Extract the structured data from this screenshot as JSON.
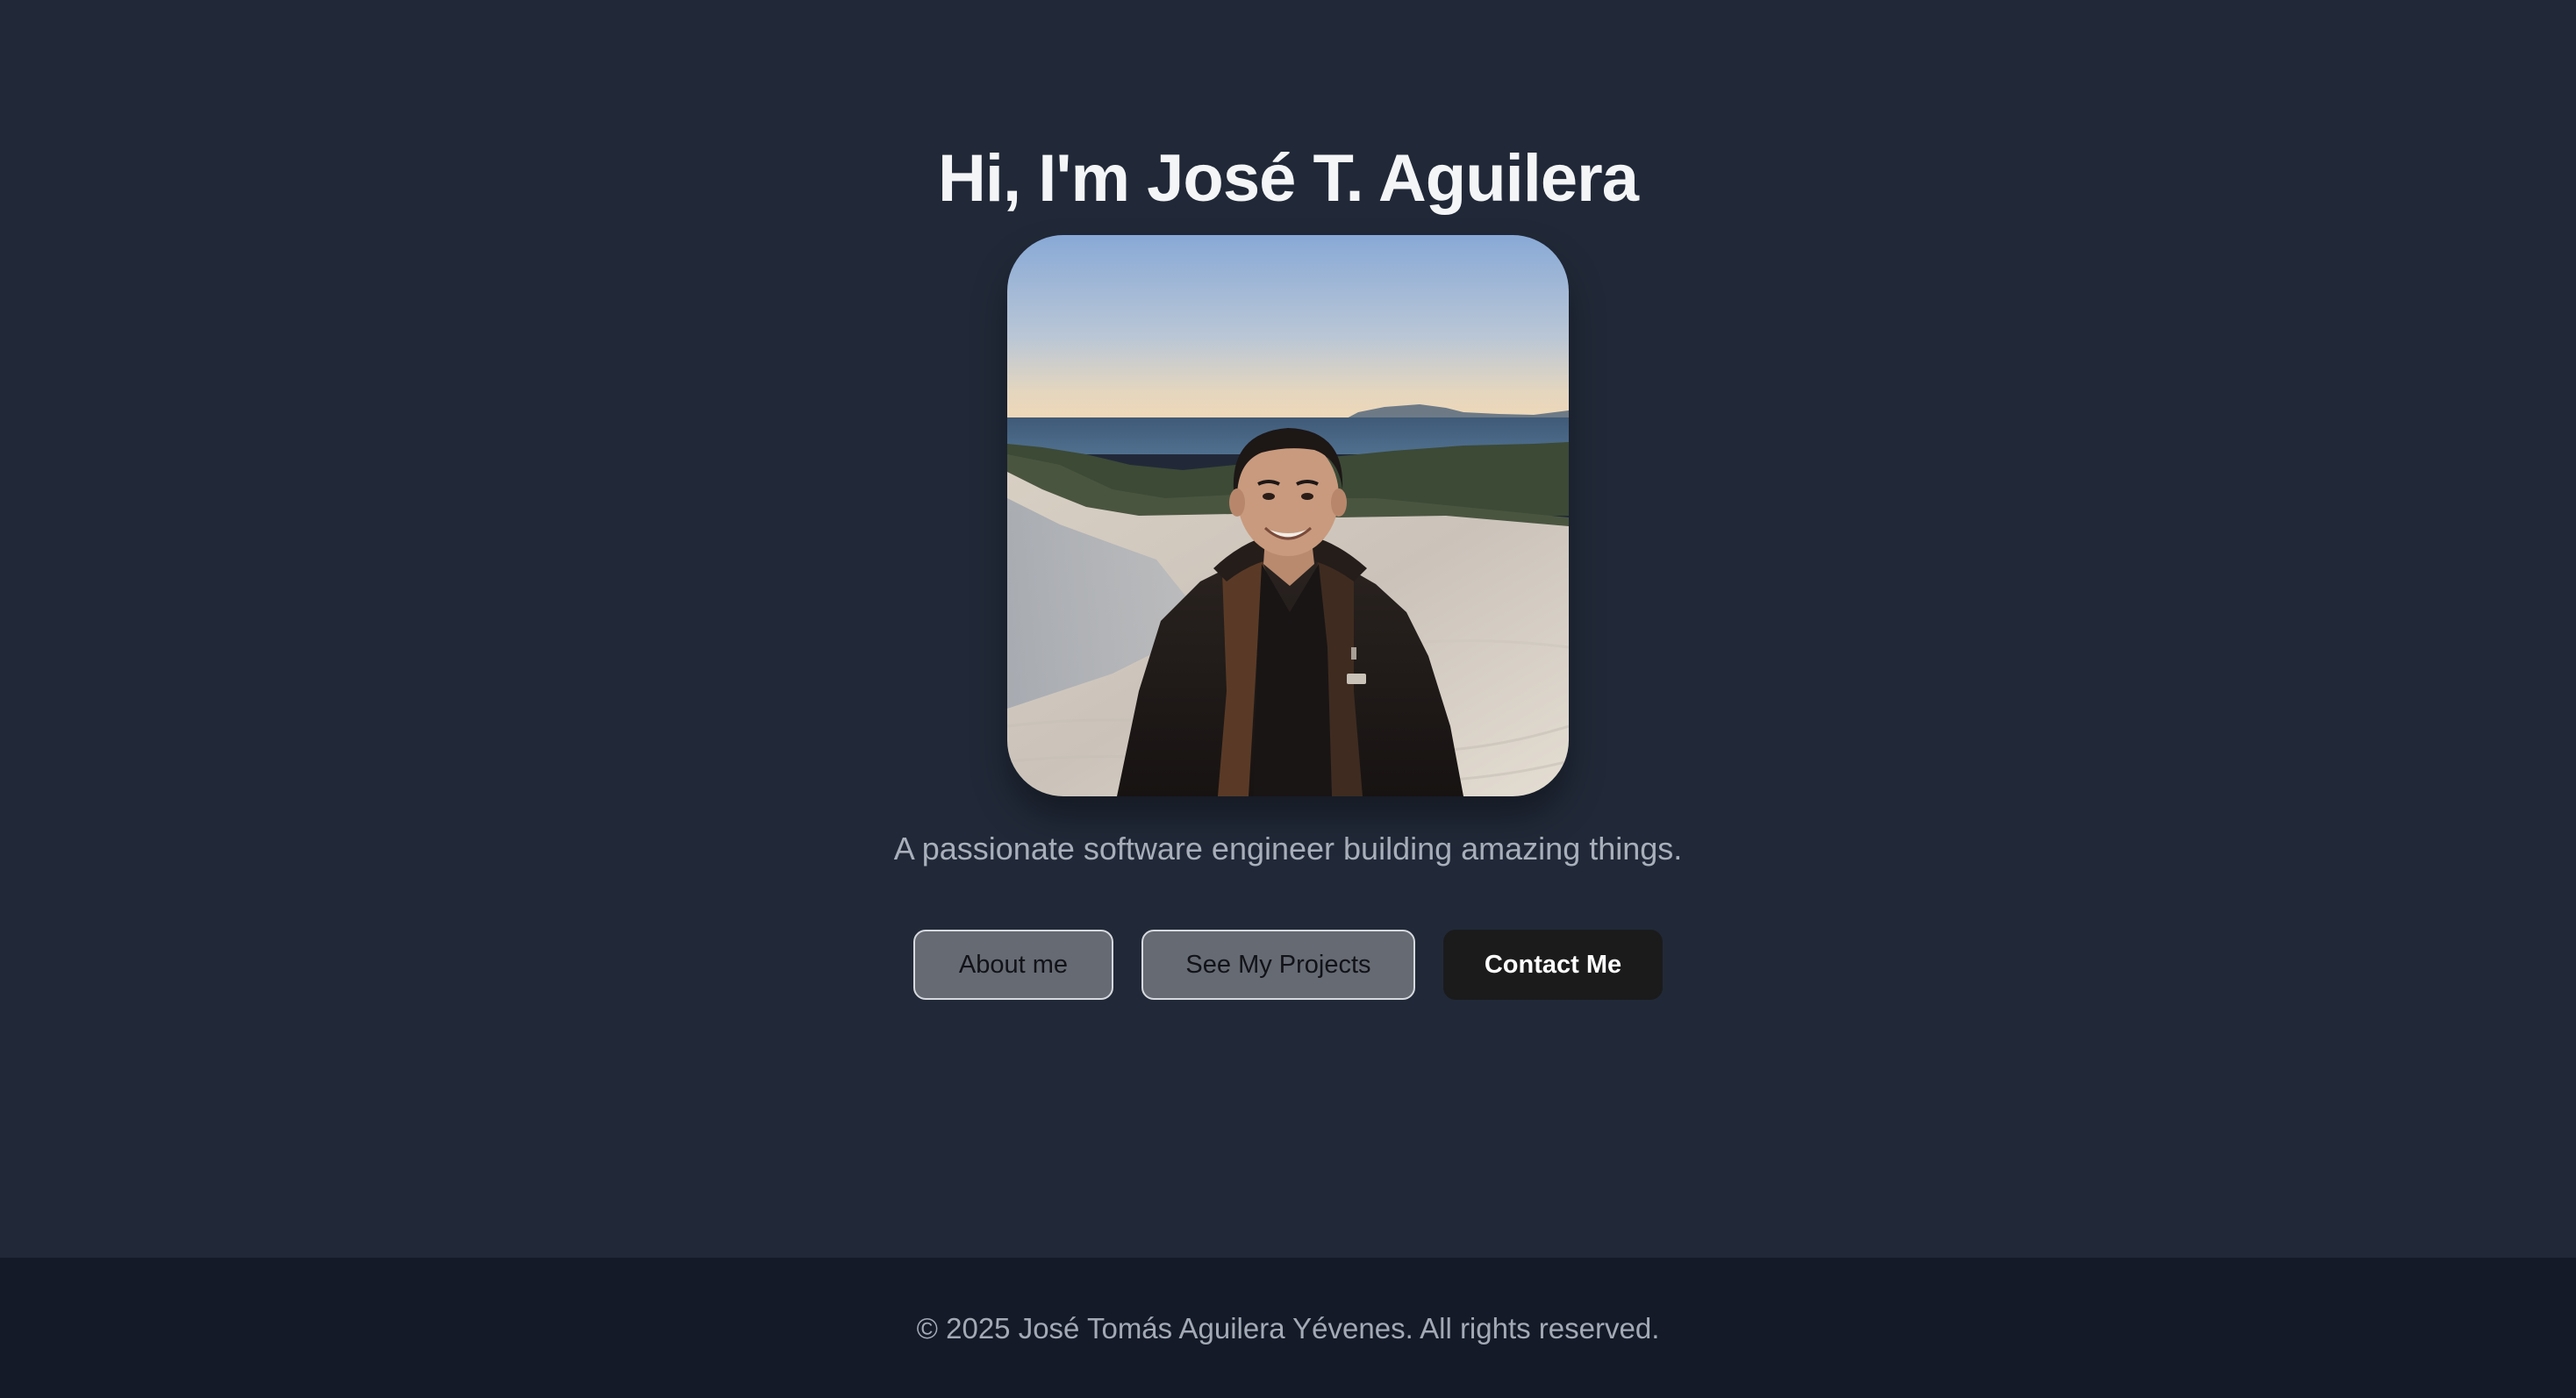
{
  "hero": {
    "title": "Hi, I'm José T. Aguilera",
    "tagline": "A passionate software engineer building amazing things.",
    "portrait_alt": "portrait"
  },
  "actions": {
    "about_label": "About me",
    "projects_label": "See My Projects",
    "contact_label": "Contact Me"
  },
  "footer": {
    "copyright": "© 2025 José Tomás Aguilera Yévenes. All rights reserved."
  },
  "colors": {
    "background": "#212938",
    "footer_background": "#141a28",
    "title": "#f4f5f7",
    "muted_text": "#a9b0bc",
    "outline_button_bg": "#666a73",
    "primary_button_bg": "#1b1b1c"
  }
}
